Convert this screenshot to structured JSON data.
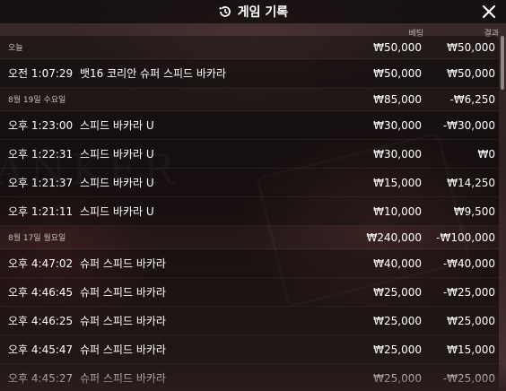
{
  "header": {
    "title": "게임 기록",
    "icon": "history-icon",
    "close_icon": "close-icon"
  },
  "columns": {
    "bet": "베팅",
    "result": "결과"
  },
  "groups": [
    {
      "date": "오늘",
      "bet_total": "₩50,000",
      "result_total": "₩50,000",
      "rows": [
        {
          "time": "오전 1:07:29",
          "game": "뱃16 코리안 슈퍼 스피드 바카라",
          "bet": "₩50,000",
          "result": "₩50,000"
        }
      ]
    },
    {
      "date": "8월 19일 수요일",
      "bet_total": "₩85,000",
      "result_total": "-₩6,250",
      "rows": [
        {
          "time": "오후 1:23:00",
          "game": "스피드 바카라 U",
          "bet": "₩30,000",
          "result": "-₩30,000"
        },
        {
          "time": "오후 1:22:31",
          "game": "스피드 바카라 U",
          "bet": "₩30,000",
          "result": "₩0"
        },
        {
          "time": "오후 1:21:37",
          "game": "스피드 바카라 U",
          "bet": "₩15,000",
          "result": "₩14,250"
        },
        {
          "time": "오후 1:21:11",
          "game": "스피드 바카라 U",
          "bet": "₩10,000",
          "result": "₩9,500"
        }
      ]
    },
    {
      "date": "8월 17일 월요일",
      "bet_total": "₩240,000",
      "result_total": "-₩100,000",
      "rows": [
        {
          "time": "오후 4:47:02",
          "game": "슈퍼 스피드 바카라",
          "bet": "₩40,000",
          "result": "-₩40,000"
        },
        {
          "time": "오후 4:46:45",
          "game": "슈퍼 스피드 바카라",
          "bet": "₩25,000",
          "result": "-₩25,000"
        },
        {
          "time": "오후 4:46:25",
          "game": "슈퍼 스피드 바카라",
          "bet": "₩25,000",
          "result": "₩25,000"
        },
        {
          "time": "오후 4:45:47",
          "game": "슈퍼 스피드 바카라",
          "bet": "₩25,000",
          "result": "₩15,000"
        },
        {
          "time": "오후 4:45:27",
          "game": "슈퍼 스피드 바카라",
          "bet": "₩25,000",
          "result": "-₩25,000"
        }
      ]
    }
  ]
}
